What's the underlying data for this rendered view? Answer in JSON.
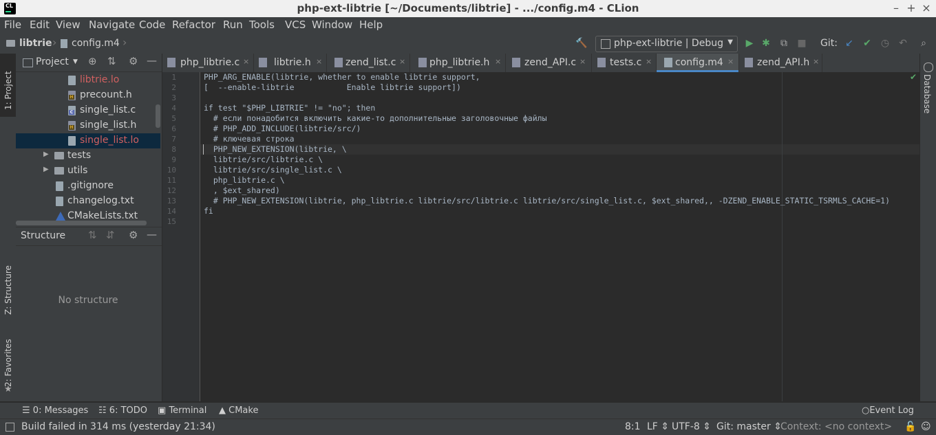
{
  "window": {
    "title": "php-ext-libtrie [~/Documents/libtrie] - .../config.m4 - CLion",
    "app_logo": "CL"
  },
  "menu": [
    "File",
    "Edit",
    "View",
    "Navigate",
    "Code",
    "Refactor",
    "Run",
    "Tools",
    "VCS",
    "Window",
    "Help"
  ],
  "breadcrumb": {
    "project": "libtrie",
    "file": "config.m4"
  },
  "run_config": {
    "label": "php-ext-libtrie | Debug"
  },
  "git": {
    "label": "Git:"
  },
  "side_tabs": {
    "project": "1: Project",
    "structure": "Z: Structure",
    "favorites": "2: Favorites",
    "database": "Database"
  },
  "project_panel": {
    "title": "Project",
    "tree": [
      {
        "name": "libtrie.lo",
        "kind": "file",
        "color": "#d06060",
        "selected": false
      },
      {
        "name": "precount.h",
        "kind": "header",
        "color": "#cfcfcf",
        "selected": false
      },
      {
        "name": "single_list.c",
        "kind": "c",
        "color": "#cfcfcf",
        "selected": false
      },
      {
        "name": "single_list.h",
        "kind": "header",
        "color": "#cfcfcf",
        "selected": false
      },
      {
        "name": "single_list.lo",
        "kind": "file",
        "color": "#d06060",
        "selected": true
      },
      {
        "name": "tests",
        "kind": "folder",
        "color": "#cfcfcf",
        "selected": false
      },
      {
        "name": "utils",
        "kind": "folder",
        "color": "#cfcfcf",
        "selected": false
      },
      {
        "name": ".gitignore",
        "kind": "file",
        "color": "#cfcfcf",
        "selected": false
      },
      {
        "name": "changelog.txt",
        "kind": "file",
        "color": "#cfcfcf",
        "selected": false
      },
      {
        "name": "CMakeLists.txt",
        "kind": "cmake",
        "color": "#cfcfcf",
        "selected": false
      }
    ]
  },
  "structure_panel": {
    "title": "Structure",
    "empty_text": "No structure"
  },
  "tabs": [
    {
      "label": "php_libtrie.c",
      "active": false
    },
    {
      "label": "libtrie.h",
      "active": false
    },
    {
      "label": "zend_list.c",
      "active": false
    },
    {
      "label": "php_libtrie.h",
      "active": false
    },
    {
      "label": "zend_API.c",
      "active": false
    },
    {
      "label": "tests.c",
      "active": false
    },
    {
      "label": "config.m4",
      "active": true
    },
    {
      "label": "zend_API.h",
      "active": false
    }
  ],
  "editor": {
    "current_line": 8,
    "lines": [
      "PHP_ARG_ENABLE(libtrie, whether to enable libtrie support,",
      "[  --enable-libtrie           Enable libtrie support])",
      "",
      "if test \"$PHP_LIBTRIE\" != \"no\"; then",
      "  # если понадобится включить какие-то дополнительные заголовочные файлы",
      "  # PHP_ADD_INCLUDE(libtrie/src/)",
      "  # ключевая строка",
      "  PHP_NEW_EXTENSION(libtrie, \\",
      "  libtrie/src/libtrie.c \\",
      "  libtrie/src/single_list.c \\",
      "  php_libtrie.c \\",
      "  , $ext_shared)",
      "  # PHP_NEW_EXTENSION(libtrie, php_libtrie.c libtrie/src/libtrie.c libtrie/src/single_list.c, $ext_shared,, -DZEND_ENABLE_STATIC_TSRMLS_CACHE=1)",
      "fi",
      ""
    ]
  },
  "tool_windows": {
    "messages": "0: Messages",
    "todo": "6: TODO",
    "terminal": "Terminal",
    "cmake": "CMake",
    "event_log": "Event Log"
  },
  "status": {
    "message": "Build failed in 314 ms (yesterday 21:34)",
    "position": "8:1",
    "line_sep": "LF",
    "encoding": "UTF-8",
    "vcs": "Git: master",
    "context": "Context: <no context>"
  }
}
